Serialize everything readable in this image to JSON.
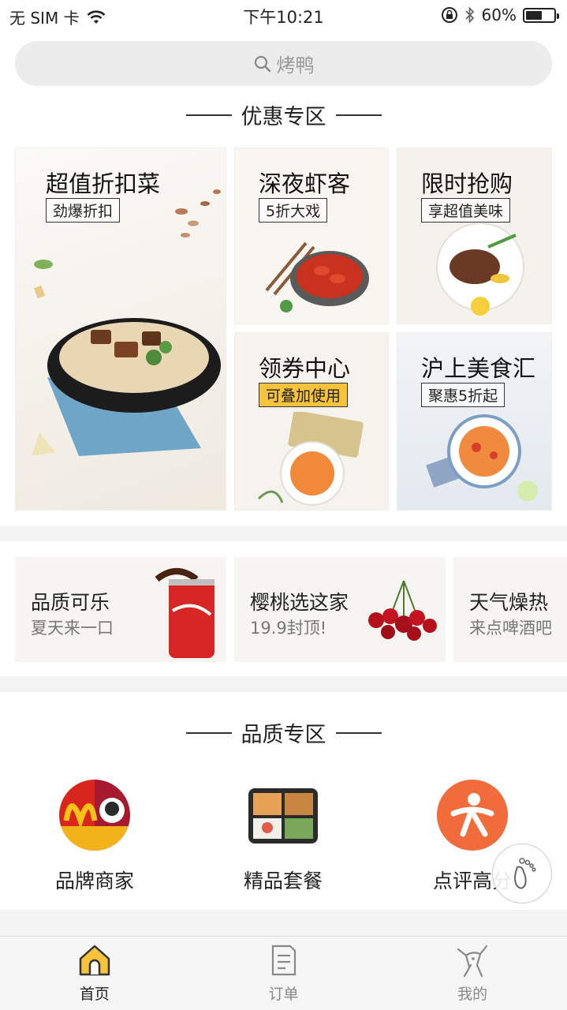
{
  "status_bar": {
    "carrier": "无 SIM 卡",
    "time": "下午10:21",
    "battery": "60%",
    "battery_level": 0.6
  },
  "search": {
    "placeholder": "烤鸭"
  },
  "promo_section": {
    "title": "优惠专区",
    "cards": [
      {
        "title": "超值折扣菜",
        "tag": "劲爆折扣"
      },
      {
        "title": "深夜虾客",
        "tag": "5折大戏"
      },
      {
        "title": "限时抢购",
        "tag": "享超值美味"
      },
      {
        "title": "领券中心",
        "tag": "可叠加使用"
      },
      {
        "title": "沪上美食汇",
        "tag": "聚惠5折起"
      }
    ]
  },
  "scroll_cards": [
    {
      "title": "品质可乐",
      "subtitle": "夏天来一口"
    },
    {
      "title": "樱桃选这家",
      "subtitle": "19.9封顶!"
    },
    {
      "title": "天气燥热",
      "subtitle": "来点啤酒吧"
    }
  ],
  "quality_section": {
    "title": "品质专区",
    "items": [
      {
        "label": "品牌商家"
      },
      {
        "label": "精品套餐"
      },
      {
        "label": "点评高分"
      }
    ]
  },
  "tabbar": {
    "tabs": [
      {
        "label": "首页",
        "icon": "home-icon",
        "active": true
      },
      {
        "label": "订单",
        "icon": "order-icon",
        "active": false
      },
      {
        "label": "我的",
        "icon": "profile-icon",
        "active": false
      }
    ]
  },
  "colors": {
    "accent": "#f6c33a",
    "orange": "#f26b3a",
    "search_bg": "#ececec"
  }
}
